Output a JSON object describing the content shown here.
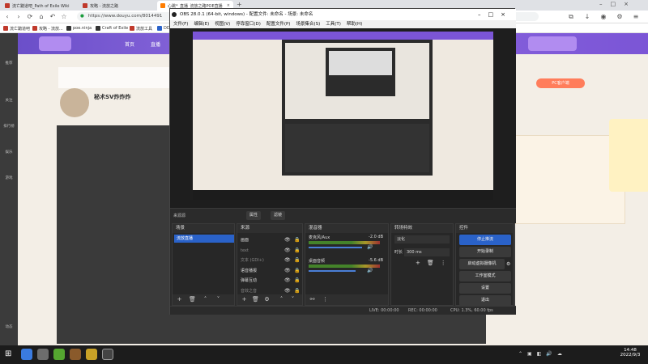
{
  "browser": {
    "tabs": [
      {
        "label": "流亡黯道吧_Path of Exile Wiki",
        "color": "#c0392b"
      },
      {
        "label": "攻略 - 流放之路",
        "color": "#c0392b"
      },
      {
        "label": "心跳*_直播_流放之路POE直播",
        "color": "#ff7d00",
        "active": true
      }
    ],
    "url": "https://www.douyu.com/8014491",
    "bookmarks": [
      {
        "label": "流亡黯道吧",
        "color": "#c0392b"
      },
      {
        "label": "攻略 - 流放...",
        "color": "#c0392b"
      },
      {
        "label": "poe.ninja",
        "color": "#333"
      },
      {
        "label": "Craft of Exile",
        "color": "#333"
      },
      {
        "label": "流放工具",
        "color": "#c0392b"
      },
      {
        "label": "DD",
        "color": "#2a62c9"
      }
    ]
  },
  "site": {
    "nav": [
      "首页",
      "直播"
    ],
    "left_nav": [
      "推荐",
      "关注",
      "排行榜",
      "娱乐",
      "游戏",
      "动态"
    ],
    "streamer_name": "秘术SV炸炸炸",
    "badge_text": "PC客户端"
  },
  "obs": {
    "title": "OBS 28.0.1 (64-bit, windows) - 配置文件: 未命名 - 场景: 未命名",
    "menu": [
      "文件(F)",
      "编辑(E)",
      "视图(V)",
      "停靠窗口(D)",
      "配置文件(P)",
      "场景集合(S)",
      "工具(T)",
      "帮助(H)"
    ],
    "toolbar": {
      "label": "来源源",
      "properties": "属性",
      "filters": "滤镜"
    },
    "scenes": {
      "title": "场景",
      "items": [
        "流放直播"
      ]
    },
    "sources": {
      "title": "来源",
      "items": [
        "画面",
        "text",
        "文本 (GDI+)",
        "语音播报",
        "弹幕互动",
        "音效之音"
      ]
    },
    "mixer": {
      "title": "混音器",
      "channels": [
        {
          "name": "麦克风/Aux",
          "db": "-2.0 dB"
        },
        {
          "name": "桌面音频",
          "db": "-5.6 dB"
        }
      ]
    },
    "transitions": {
      "title": "转场特效",
      "type": "淡化",
      "duration_label": "时长",
      "duration": "300 ms"
    },
    "controls": {
      "title": "控件",
      "buttons": [
        "停止推流",
        "开始录制",
        "启动虚拟摄像机",
        "工作室模式",
        "设置",
        "退出"
      ]
    },
    "status": {
      "live": "LIVE: 00:00:00",
      "rec": "REC: 00:00:00",
      "cpu": "CPU: 1.3%, 60.00 fps"
    }
  },
  "taskbar": {
    "time": "14:48",
    "date": "2022/9/3"
  }
}
